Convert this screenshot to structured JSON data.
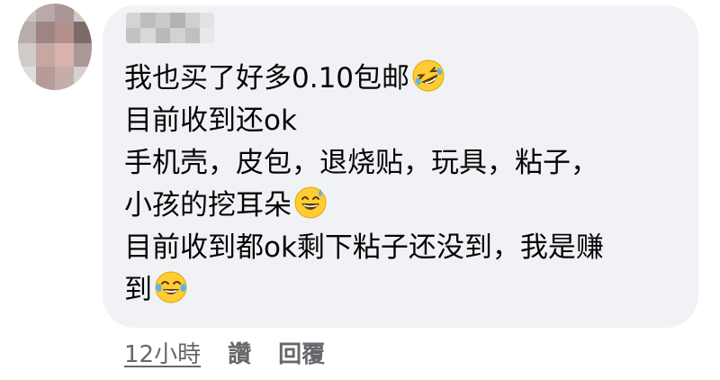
{
  "comment": {
    "lines": [
      {
        "text": "我也买了好多0.10包邮",
        "emoji": "rolling-on-floor-laughing-emoji"
      },
      {
        "text": "目前收到还ok",
        "emoji": ""
      },
      {
        "text": "手机壳，皮包，退烧贴，玩具，粘子，",
        "emoji": ""
      },
      {
        "text": "小孩的挖耳朵",
        "emoji": "grinning-sweat-emoji"
      },
      {
        "text": "目前收到都ok剩下粘子还没到，我是赚",
        "emoji": ""
      },
      {
        "text": "到",
        "emoji": "tears-of-joy-emoji"
      }
    ]
  },
  "actions": {
    "timestamp": "12小時",
    "like_label": "讚",
    "reply_label": "回覆"
  },
  "colors": {
    "bubble_background": "#f0f2f5",
    "text_primary": "#050505",
    "text_secondary": "#65676b",
    "emoji_yellow": "#ffcc33"
  }
}
